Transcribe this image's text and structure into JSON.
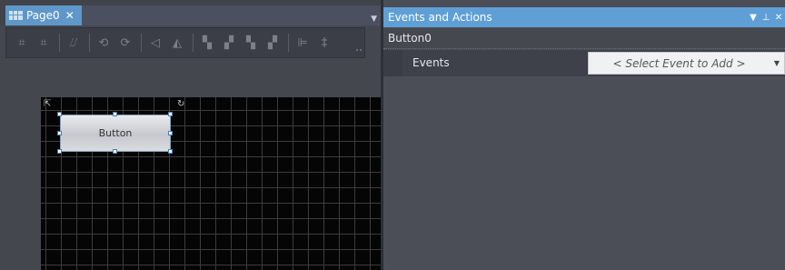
{
  "left_panel": {
    "tab": {
      "label": "Page0",
      "close": "✕",
      "icon": "grid-page-icon"
    },
    "tab_dropdown": "▼",
    "toolbar": {
      "buttons": [
        {
          "name": "group-icon",
          "glyph": "⌗"
        },
        {
          "name": "ungroup-icon",
          "glyph": "⌗"
        },
        {
          "name": "shape-edit-icon",
          "glyph": "⌰"
        },
        {
          "name": "rotate-left-icon",
          "glyph": "⟲"
        },
        {
          "name": "rotate-right-icon",
          "glyph": "⟳"
        },
        {
          "name": "flip-vertical-icon",
          "glyph": "◁"
        },
        {
          "name": "flip-horizontal-icon",
          "glyph": "◭"
        },
        {
          "name": "bring-to-front-icon",
          "glyph": "▚"
        },
        {
          "name": "bring-forward-icon",
          "glyph": "▞"
        },
        {
          "name": "send-backward-icon",
          "glyph": "▚"
        },
        {
          "name": "send-to-back-icon",
          "glyph": "▞"
        },
        {
          "name": "align-left-icon",
          "glyph": "⊫"
        },
        {
          "name": "align-center-icon",
          "glyph": "‡"
        }
      ]
    },
    "canvas": {
      "button_label": "Button",
      "corner_left_icon": "⇱",
      "corner_right_icon": "↻"
    }
  },
  "right_panel": {
    "title": "Events and Actions",
    "controls": {
      "dropdown": "▼",
      "pin": "⊥",
      "close": "✕"
    },
    "object_name": "Button0",
    "events_label": "Events",
    "event_select": {
      "value": "< Select Event to Add >",
      "arrow": "▼"
    }
  },
  "colors": {
    "tab_accent": "#5f97c9",
    "title_accent": "#5f9fd6",
    "canvas_bg": "#050505"
  }
}
